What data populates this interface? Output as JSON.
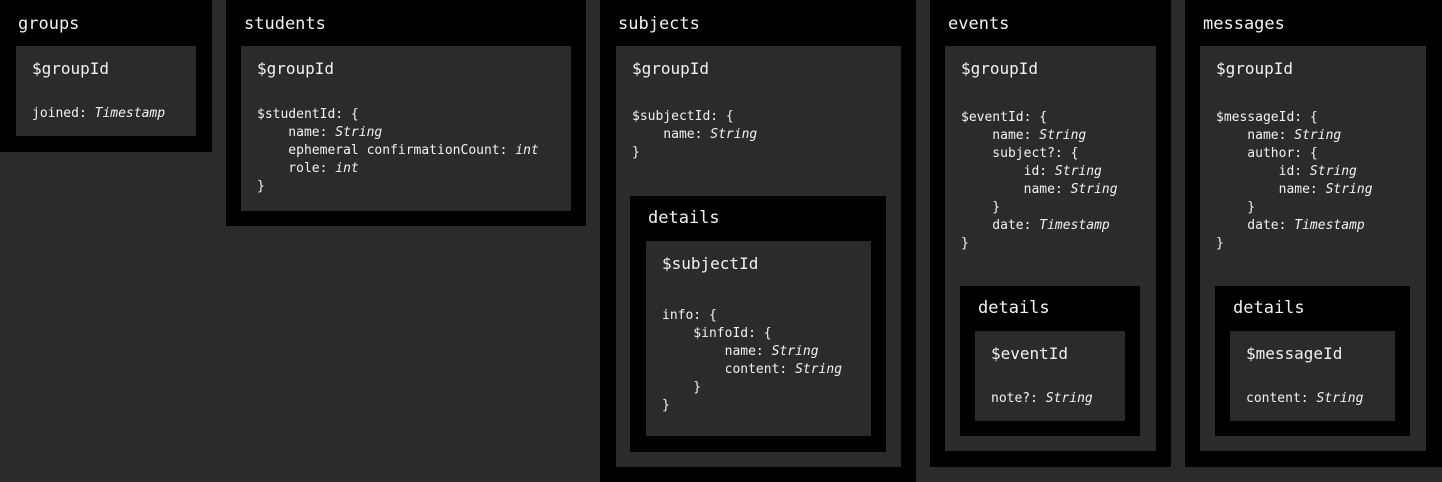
{
  "collections": [
    {
      "id": "groups",
      "title": "groups",
      "doc": {
        "id_label": "$groupId",
        "lines": [
          {
            "indent": 0,
            "key": "joined: ",
            "type": "Timestamp"
          }
        ]
      }
    },
    {
      "id": "students",
      "title": "students",
      "doc": {
        "id_label": "$groupId",
        "lines": [
          {
            "indent": 0,
            "key": "$studentId: {",
            "type": ""
          },
          {
            "indent": 1,
            "key": "name: ",
            "type": "String"
          },
          {
            "indent": 1,
            "key": "ephemeral confirmationCount: ",
            "type": "int"
          },
          {
            "indent": 1,
            "key": "role: ",
            "type": "int"
          },
          {
            "indent": 0,
            "key": "}",
            "type": ""
          }
        ]
      }
    },
    {
      "id": "subjects",
      "title": "subjects",
      "doc": {
        "id_label": "$groupId",
        "lines": [
          {
            "indent": 0,
            "key": "$subjectId: {",
            "type": ""
          },
          {
            "indent": 1,
            "key": "name: ",
            "type": "String"
          },
          {
            "indent": 0,
            "key": "}",
            "type": ""
          }
        ]
      },
      "sub": {
        "title": "details",
        "doc": {
          "id_label": "$subjectId",
          "lines": [
            {
              "indent": 0,
              "key": "info: {",
              "type": ""
            },
            {
              "indent": 1,
              "key": "$infoId: {",
              "type": ""
            },
            {
              "indent": 2,
              "key": "name: ",
              "type": "String"
            },
            {
              "indent": 2,
              "key": "content: ",
              "type": "String"
            },
            {
              "indent": 1,
              "key": "}",
              "type": ""
            },
            {
              "indent": 0,
              "key": "}",
              "type": ""
            }
          ]
        }
      }
    },
    {
      "id": "events",
      "title": "events",
      "doc": {
        "id_label": "$groupId",
        "lines": [
          {
            "indent": 0,
            "key": "$eventId: {",
            "type": ""
          },
          {
            "indent": 1,
            "key": "name: ",
            "type": "String"
          },
          {
            "indent": 1,
            "key": "subject?: {",
            "type": ""
          },
          {
            "indent": 2,
            "key": "id: ",
            "type": "String"
          },
          {
            "indent": 2,
            "key": "name: ",
            "type": "String"
          },
          {
            "indent": 1,
            "key": "}",
            "type": ""
          },
          {
            "indent": 1,
            "key": "date: ",
            "type": "Timestamp"
          },
          {
            "indent": 0,
            "key": "}",
            "type": ""
          }
        ]
      },
      "sub": {
        "title": "details",
        "doc": {
          "id_label": "$eventId",
          "lines": [
            {
              "indent": 0,
              "key": "note?: ",
              "type": "String"
            }
          ]
        }
      }
    },
    {
      "id": "messages",
      "title": "messages",
      "doc": {
        "id_label": "$groupId",
        "lines": [
          {
            "indent": 0,
            "key": "$messageId: {",
            "type": ""
          },
          {
            "indent": 1,
            "key": "name: ",
            "type": "String"
          },
          {
            "indent": 1,
            "key": "author: {",
            "type": ""
          },
          {
            "indent": 2,
            "key": "id: ",
            "type": "String"
          },
          {
            "indent": 2,
            "key": "name: ",
            "type": "String"
          },
          {
            "indent": 1,
            "key": "}",
            "type": ""
          },
          {
            "indent": 1,
            "key": "date: ",
            "type": "Timestamp"
          },
          {
            "indent": 0,
            "key": "}",
            "type": ""
          }
        ]
      },
      "sub": {
        "title": "details",
        "doc": {
          "id_label": "$messageId",
          "lines": [
            {
              "indent": 0,
              "key": "content: ",
              "type": "String"
            }
          ]
        }
      }
    }
  ]
}
